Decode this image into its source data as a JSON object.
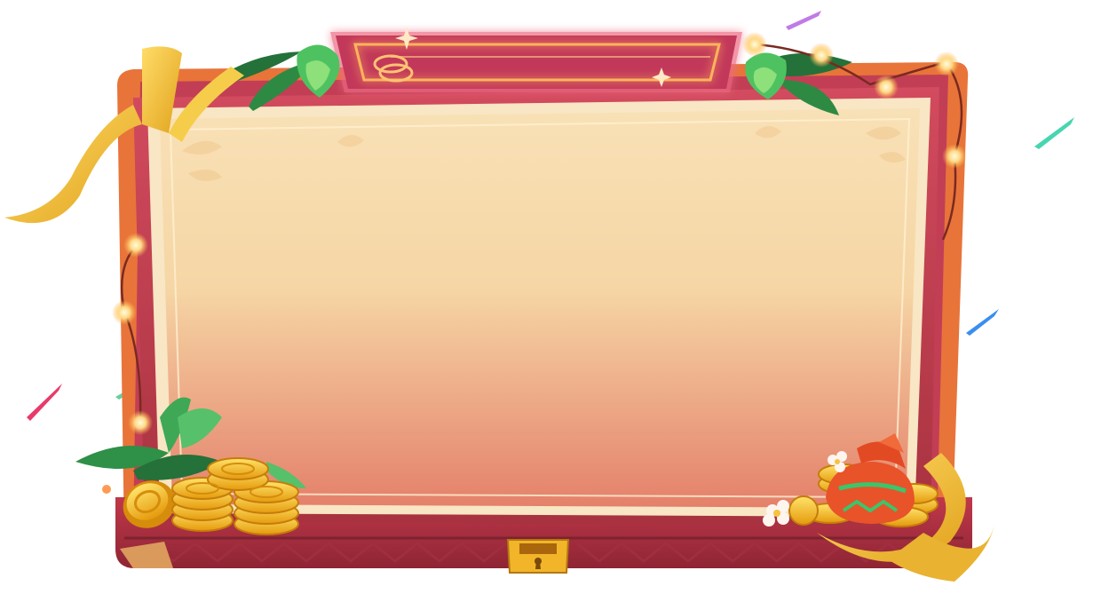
{
  "game": {
    "panel_title": "",
    "coin_icon": "coin-icon",
    "lock_icon": "keyhole-icon"
  },
  "colors": {
    "frame_red": "#c63f5a",
    "frame_orange": "#e8763a",
    "paper_top": "#f8e2b8",
    "paper_bottom": "#e68a6a",
    "title_bar": "#c2385a",
    "neon_orange": "#ffb35c",
    "gold": "#f7b81a",
    "leaf_green": "#2d8a3e",
    "ribbon_gold": "#f2c23a"
  }
}
